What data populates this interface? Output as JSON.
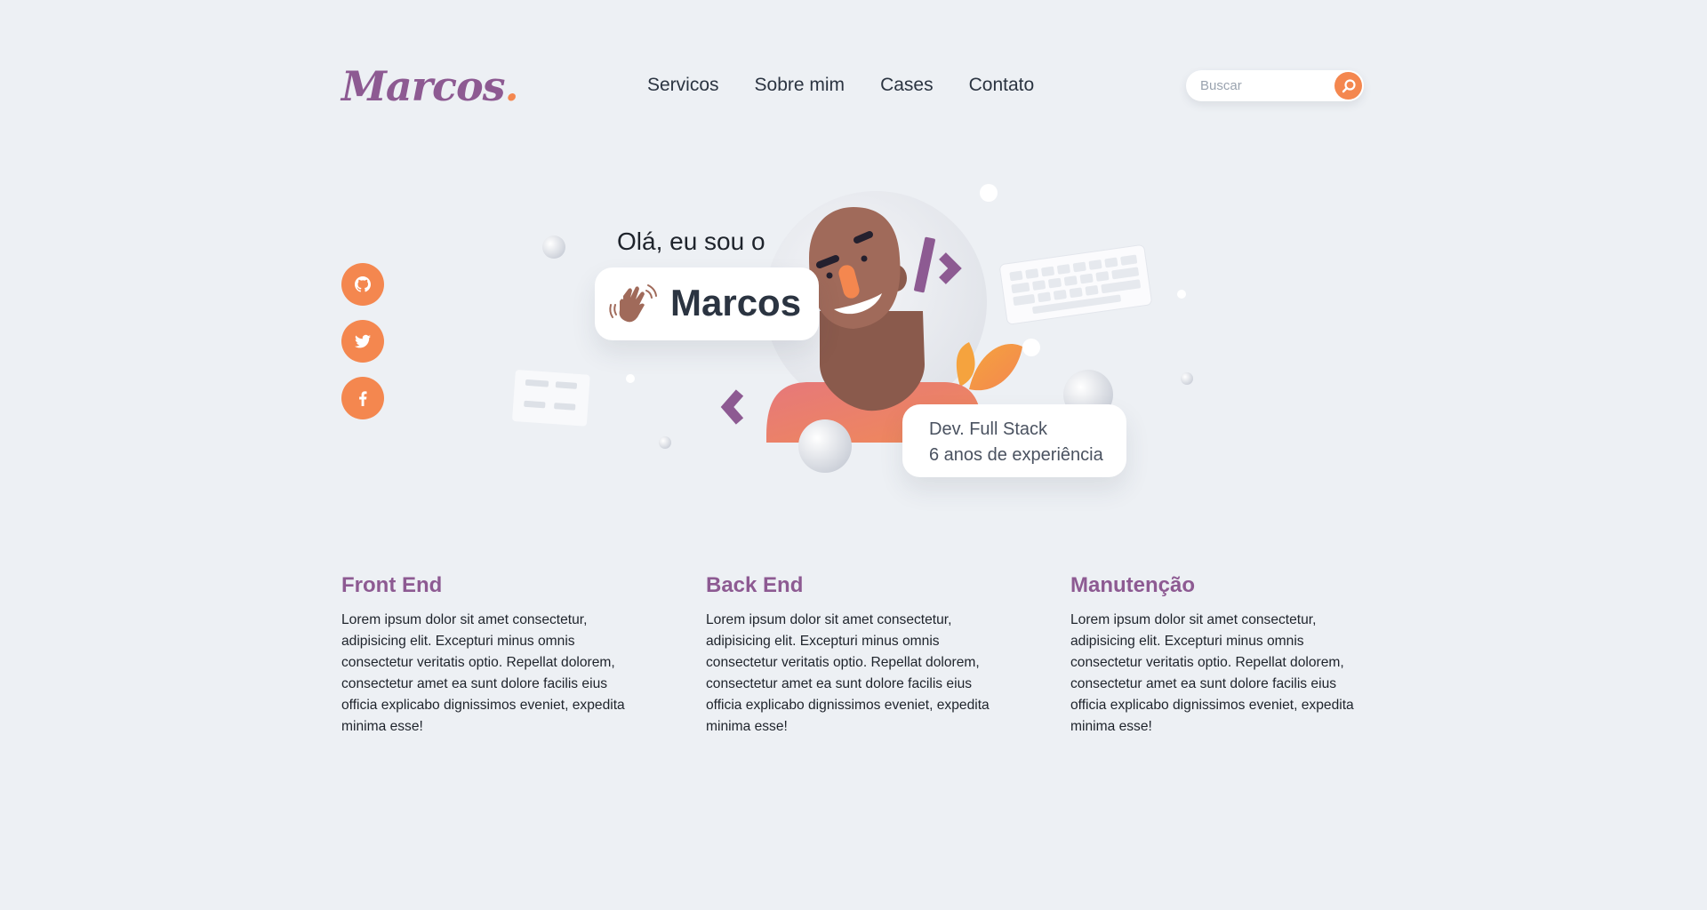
{
  "header": {
    "logo_text": "Marcos",
    "logo_dot": ".",
    "nav": [
      "Servicos",
      "Sobre mim",
      "Cases",
      "Contato"
    ],
    "search": {
      "placeholder": "Buscar",
      "value": "",
      "icon": "search-icon"
    }
  },
  "social": [
    {
      "icon": "github-icon"
    },
    {
      "icon": "twitter-icon"
    },
    {
      "icon": "facebook-icon"
    }
  ],
  "hero": {
    "greeting": "Olá, eu sou o",
    "name": "Marcos",
    "wave_icon": "waving-hand-icon",
    "role_line1": "Dev. Full Stack",
    "role_line2": "6 anos de experiência"
  },
  "services": [
    {
      "title": "Front End",
      "text": "Lorem ipsum dolor sit amet consectetur, adipisicing elit. Excepturi minus omnis consectetur veritatis optio. Repellat dolorem, consectetur amet ea sunt dolore facilis eius officia explicabo dignissimos eveniet, expedita minima esse!"
    },
    {
      "title": "Back End",
      "text": "Lorem ipsum dolor sit amet consectetur, adipisicing elit. Excepturi minus omnis consectetur veritatis optio. Repellat dolorem, consectetur amet ea sunt dolore facilis eius officia explicabo dignissimos eveniet, expedita minima esse!"
    },
    {
      "title": "Manutenção",
      "text": "Lorem ipsum dolor sit amet consectetur, adipisicing elit. Excepturi minus omnis consectetur veritatis optio. Repellat dolorem, consectetur amet ea sunt dolore facilis eius officia explicabo dignissimos eveniet, expedita minima esse!"
    }
  ],
  "colors": {
    "accent": "#f4874f",
    "brand": "#8d5a92",
    "background": "#edf0f4",
    "text": "#2b3441"
  }
}
